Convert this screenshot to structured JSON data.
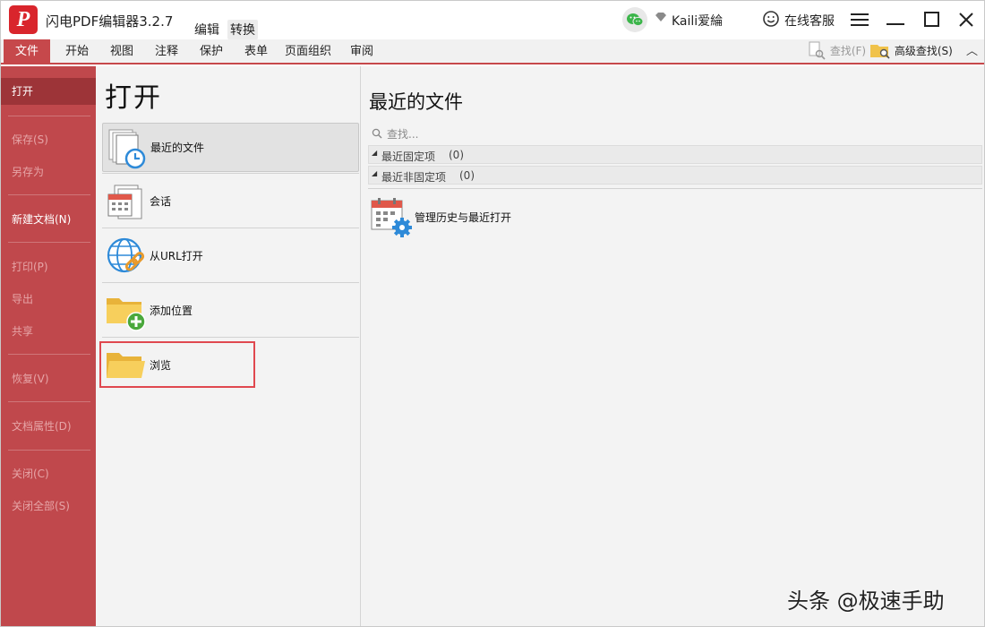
{
  "titlebar": {
    "logo_text": "P",
    "app_title": "闪电PDF编辑器3.2.7",
    "modes": [
      "编辑",
      "转换"
    ],
    "username": "Kaili爱綸",
    "customer_service": "在线客服",
    "icons": [
      "wechat-icon",
      "vip-diamond-icon",
      "smiley-icon",
      "menu-icon",
      "minimize-icon",
      "maximize-icon",
      "close-icon"
    ]
  },
  "ribbon": {
    "tabs": [
      "文件",
      "开始",
      "视图",
      "注释",
      "保护",
      "表单",
      "页面组织",
      "审阅"
    ],
    "active_tab": "文件",
    "find": "查找(F)",
    "advanced_find": "高级查找(S)"
  },
  "sidebar": {
    "items": [
      {
        "label": "打开",
        "active": true
      },
      {
        "label": "保存(S)",
        "enabled": false
      },
      {
        "label": "另存为",
        "enabled": false
      },
      {
        "label": "新建文档(N)",
        "enabled": true
      },
      {
        "label": "打印(P)",
        "enabled": false
      },
      {
        "label": "导出",
        "enabled": false
      },
      {
        "label": "共享",
        "enabled": false
      },
      {
        "label": "恢复(V)",
        "enabled": false
      },
      {
        "label": "文档属性(D)",
        "enabled": false
      },
      {
        "label": "关闭(C)",
        "enabled": false
      },
      {
        "label": "关闭全部(S)",
        "enabled": false
      }
    ]
  },
  "open_panel": {
    "title": "打开",
    "options": [
      {
        "label": "最近的文件",
        "icon": "recent-files-icon",
        "selected": true
      },
      {
        "label": "会话",
        "icon": "session-icon"
      },
      {
        "label": "从URL打开",
        "icon": "globe-link-icon"
      },
      {
        "label": "添加位置",
        "icon": "add-folder-icon"
      },
      {
        "label": "浏览",
        "icon": "folder-icon",
        "highlighted": true
      }
    ]
  },
  "recent": {
    "title": "最近的文件",
    "search_placeholder": "查找...",
    "groups": [
      {
        "label": "最近固定项",
        "count": "(0)"
      },
      {
        "label": "最近非固定项",
        "count": "(0)"
      }
    ],
    "manage_label": "管理历史与最近打开"
  },
  "watermark": "头条 @极速手助",
  "colors": {
    "accent": "#c6484b",
    "sidebar": "#c0484c",
    "highlight_box": "#e0484f"
  }
}
